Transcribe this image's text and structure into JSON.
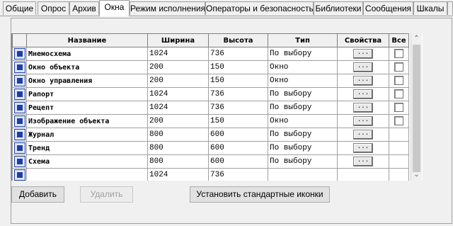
{
  "tabs": [
    {
      "label": "Общие"
    },
    {
      "label": "Опрос"
    },
    {
      "label": "Архив"
    },
    {
      "label": "Окна"
    },
    {
      "label": "Режим исполнения"
    },
    {
      "label": "Операторы и безопасность"
    },
    {
      "label": "Библиотеки"
    },
    {
      "label": "Сообщения"
    },
    {
      "label": "Шкалы"
    }
  ],
  "table": {
    "headers": {
      "name": "Название",
      "width": "Ширина",
      "height": "Высота",
      "type": "Тип",
      "props": "Свойства",
      "all": "Все"
    },
    "rows": [
      {
        "icon": "mnemoscheme-icon",
        "name": "Мнемосхема",
        "width": "1024",
        "height": "736",
        "type": "По выбору",
        "props": "...",
        "all_checkbox": true
      },
      {
        "icon": "object-window-icon",
        "name": "Окно объекта",
        "width": "200",
        "height": "150",
        "type": "Окно",
        "props": "...",
        "all_checkbox": true
      },
      {
        "icon": "control-window-icon",
        "name": "Окно управления",
        "width": "200",
        "height": "150",
        "type": "Окно",
        "props": "...",
        "all_checkbox": true
      },
      {
        "icon": "report-icon",
        "name": "Рапорт",
        "width": "1024",
        "height": "736",
        "type": "По выбору",
        "props": "...",
        "all_checkbox": true
      },
      {
        "icon": "recipe-icon",
        "name": "Рецепт",
        "width": "1024",
        "height": "736",
        "type": "По выбору",
        "props": "...",
        "all_checkbox": true
      },
      {
        "icon": "object-image-icon",
        "name": "Изображение объекта",
        "width": "200",
        "height": "150",
        "type": "Окно",
        "props": "...",
        "all_checkbox": true
      },
      {
        "icon": "journal-icon",
        "name": "Журнал",
        "width": "800",
        "height": "600",
        "type": "По выбору",
        "props": "...",
        "all_checkbox": false
      },
      {
        "icon": "trend-icon",
        "name": "Тренд",
        "width": "800",
        "height": "600",
        "type": "По выбору",
        "props": "...",
        "all_checkbox": false
      },
      {
        "icon": "scheme-icon",
        "name": "Схема",
        "width": "800",
        "height": "600",
        "type": "По выбору",
        "props": "...",
        "all_checkbox": false
      },
      {
        "icon": "partial-row-icon",
        "name": "",
        "width": "1024",
        "height": "736",
        "type": "",
        "props": "",
        "all_checkbox": false
      }
    ]
  },
  "buttons": {
    "add": "Добавить",
    "delete": "Удалить",
    "set_icons": "Установить стандартные иконки"
  }
}
